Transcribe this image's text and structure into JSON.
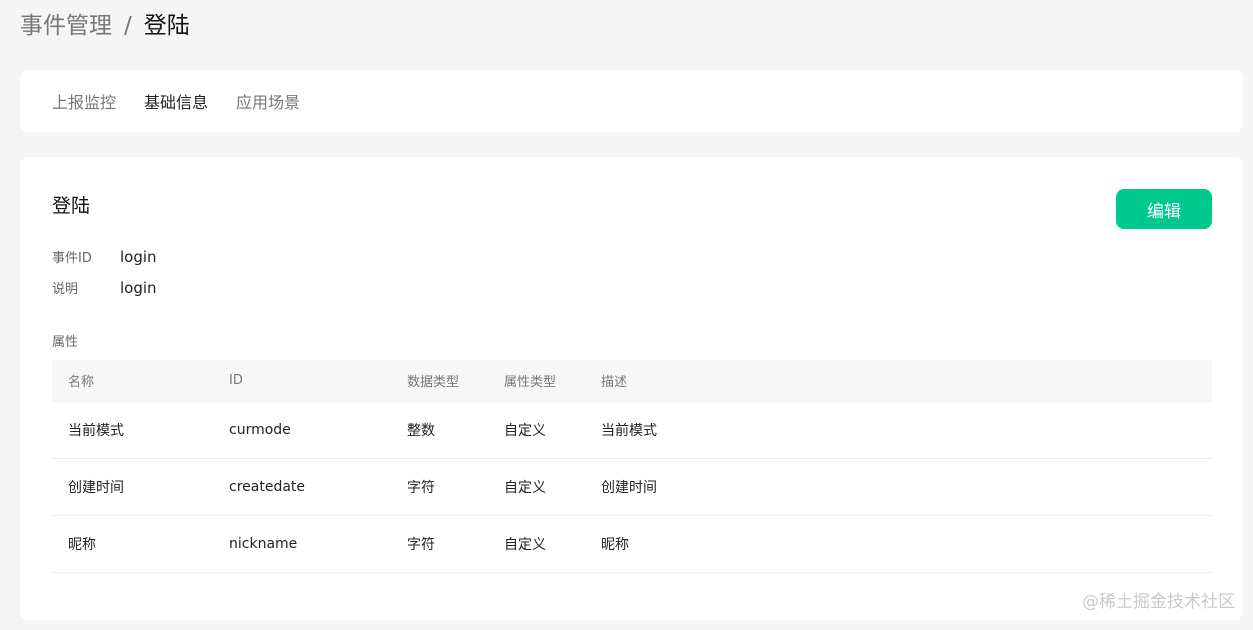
{
  "breadcrumb": {
    "parent": "事件管理",
    "separator": "/",
    "current": "登陆"
  },
  "tabs": [
    {
      "label": "上报监控",
      "active": false
    },
    {
      "label": "基础信息",
      "active": true
    },
    {
      "label": "应用场景",
      "active": false
    }
  ],
  "event": {
    "title": "登陆",
    "edit_label": "编辑",
    "id_label": "事件ID",
    "id_value": "login",
    "desc_label": "说明",
    "desc_value": "login"
  },
  "attributes": {
    "section_label": "属性",
    "columns": [
      "名称",
      "ID",
      "数据类型",
      "属性类型",
      "描述"
    ],
    "rows": [
      [
        "当前模式",
        "curmode",
        "整数",
        "自定义",
        "当前模式"
      ],
      [
        "创建时间",
        "createdate",
        "字符",
        "自定义",
        "创建时间"
      ],
      [
        "昵称",
        "nickname",
        "字符",
        "自定义",
        "昵称"
      ]
    ]
  },
  "watermark": "@稀土掘金技术社区",
  "colors": {
    "accent": "#00c98d",
    "background": "#f5f5f5"
  }
}
